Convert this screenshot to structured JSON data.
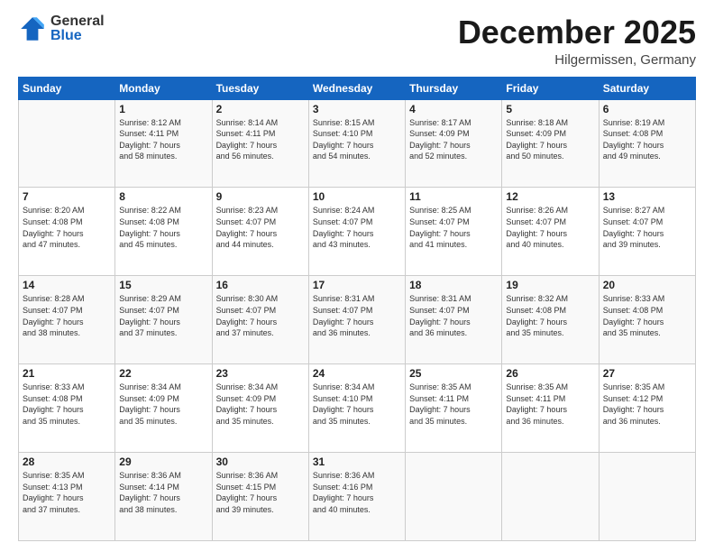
{
  "header": {
    "logo_general": "General",
    "logo_blue": "Blue",
    "month": "December 2025",
    "location": "Hilgermissen, Germany"
  },
  "days_of_week": [
    "Sunday",
    "Monday",
    "Tuesday",
    "Wednesday",
    "Thursday",
    "Friday",
    "Saturday"
  ],
  "weeks": [
    [
      {
        "day": "",
        "info": ""
      },
      {
        "day": "1",
        "info": "Sunrise: 8:12 AM\nSunset: 4:11 PM\nDaylight: 7 hours\nand 58 minutes."
      },
      {
        "day": "2",
        "info": "Sunrise: 8:14 AM\nSunset: 4:11 PM\nDaylight: 7 hours\nand 56 minutes."
      },
      {
        "day": "3",
        "info": "Sunrise: 8:15 AM\nSunset: 4:10 PM\nDaylight: 7 hours\nand 54 minutes."
      },
      {
        "day": "4",
        "info": "Sunrise: 8:17 AM\nSunset: 4:09 PM\nDaylight: 7 hours\nand 52 minutes."
      },
      {
        "day": "5",
        "info": "Sunrise: 8:18 AM\nSunset: 4:09 PM\nDaylight: 7 hours\nand 50 minutes."
      },
      {
        "day": "6",
        "info": "Sunrise: 8:19 AM\nSunset: 4:08 PM\nDaylight: 7 hours\nand 49 minutes."
      }
    ],
    [
      {
        "day": "7",
        "info": "Sunrise: 8:20 AM\nSunset: 4:08 PM\nDaylight: 7 hours\nand 47 minutes."
      },
      {
        "day": "8",
        "info": "Sunrise: 8:22 AM\nSunset: 4:08 PM\nDaylight: 7 hours\nand 45 minutes."
      },
      {
        "day": "9",
        "info": "Sunrise: 8:23 AM\nSunset: 4:07 PM\nDaylight: 7 hours\nand 44 minutes."
      },
      {
        "day": "10",
        "info": "Sunrise: 8:24 AM\nSunset: 4:07 PM\nDaylight: 7 hours\nand 43 minutes."
      },
      {
        "day": "11",
        "info": "Sunrise: 8:25 AM\nSunset: 4:07 PM\nDaylight: 7 hours\nand 41 minutes."
      },
      {
        "day": "12",
        "info": "Sunrise: 8:26 AM\nSunset: 4:07 PM\nDaylight: 7 hours\nand 40 minutes."
      },
      {
        "day": "13",
        "info": "Sunrise: 8:27 AM\nSunset: 4:07 PM\nDaylight: 7 hours\nand 39 minutes."
      }
    ],
    [
      {
        "day": "14",
        "info": "Sunrise: 8:28 AM\nSunset: 4:07 PM\nDaylight: 7 hours\nand 38 minutes."
      },
      {
        "day": "15",
        "info": "Sunrise: 8:29 AM\nSunset: 4:07 PM\nDaylight: 7 hours\nand 37 minutes."
      },
      {
        "day": "16",
        "info": "Sunrise: 8:30 AM\nSunset: 4:07 PM\nDaylight: 7 hours\nand 37 minutes."
      },
      {
        "day": "17",
        "info": "Sunrise: 8:31 AM\nSunset: 4:07 PM\nDaylight: 7 hours\nand 36 minutes."
      },
      {
        "day": "18",
        "info": "Sunrise: 8:31 AM\nSunset: 4:07 PM\nDaylight: 7 hours\nand 36 minutes."
      },
      {
        "day": "19",
        "info": "Sunrise: 8:32 AM\nSunset: 4:08 PM\nDaylight: 7 hours\nand 35 minutes."
      },
      {
        "day": "20",
        "info": "Sunrise: 8:33 AM\nSunset: 4:08 PM\nDaylight: 7 hours\nand 35 minutes."
      }
    ],
    [
      {
        "day": "21",
        "info": "Sunrise: 8:33 AM\nSunset: 4:08 PM\nDaylight: 7 hours\nand 35 minutes."
      },
      {
        "day": "22",
        "info": "Sunrise: 8:34 AM\nSunset: 4:09 PM\nDaylight: 7 hours\nand 35 minutes."
      },
      {
        "day": "23",
        "info": "Sunrise: 8:34 AM\nSunset: 4:09 PM\nDaylight: 7 hours\nand 35 minutes."
      },
      {
        "day": "24",
        "info": "Sunrise: 8:34 AM\nSunset: 4:10 PM\nDaylight: 7 hours\nand 35 minutes."
      },
      {
        "day": "25",
        "info": "Sunrise: 8:35 AM\nSunset: 4:11 PM\nDaylight: 7 hours\nand 35 minutes."
      },
      {
        "day": "26",
        "info": "Sunrise: 8:35 AM\nSunset: 4:11 PM\nDaylight: 7 hours\nand 36 minutes."
      },
      {
        "day": "27",
        "info": "Sunrise: 8:35 AM\nSunset: 4:12 PM\nDaylight: 7 hours\nand 36 minutes."
      }
    ],
    [
      {
        "day": "28",
        "info": "Sunrise: 8:35 AM\nSunset: 4:13 PM\nDaylight: 7 hours\nand 37 minutes."
      },
      {
        "day": "29",
        "info": "Sunrise: 8:36 AM\nSunset: 4:14 PM\nDaylight: 7 hours\nand 38 minutes."
      },
      {
        "day": "30",
        "info": "Sunrise: 8:36 AM\nSunset: 4:15 PM\nDaylight: 7 hours\nand 39 minutes."
      },
      {
        "day": "31",
        "info": "Sunrise: 8:36 AM\nSunset: 4:16 PM\nDaylight: 7 hours\nand 40 minutes."
      },
      {
        "day": "",
        "info": ""
      },
      {
        "day": "",
        "info": ""
      },
      {
        "day": "",
        "info": ""
      }
    ]
  ]
}
